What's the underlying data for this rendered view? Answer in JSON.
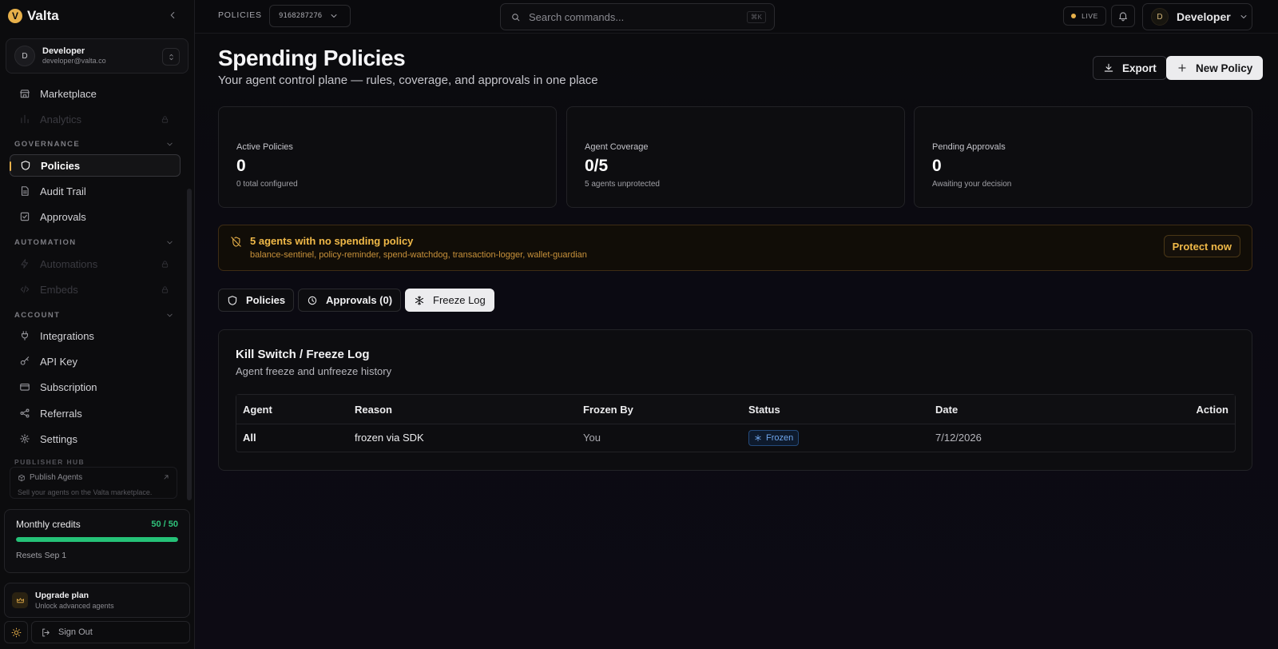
{
  "app": {
    "brand": "Valta",
    "accent_color": "#e7b04a",
    "success_color": "#25c278"
  },
  "sidebar": {
    "user": {
      "initial": "D",
      "name": "Developer",
      "email": "developer@valta.co"
    },
    "top_items": [
      {
        "label": "Marketplace",
        "icon": "store-icon"
      },
      {
        "label": "Analytics",
        "icon": "chart-icon",
        "locked": true
      }
    ],
    "sections": [
      {
        "label": "GOVERNANCE",
        "items": [
          {
            "label": "Policies",
            "icon": "shield-icon",
            "active": true
          },
          {
            "label": "Audit Trail",
            "icon": "file-icon"
          },
          {
            "label": "Approvals",
            "icon": "checkbox-icon"
          }
        ]
      },
      {
        "label": "AUTOMATION",
        "items": [
          {
            "label": "Automations",
            "icon": "zap-icon",
            "locked": true
          },
          {
            "label": "Embeds",
            "icon": "code-icon",
            "locked": true
          }
        ]
      },
      {
        "label": "ACCOUNT",
        "items": [
          {
            "label": "Integrations",
            "icon": "plug-icon"
          },
          {
            "label": "API Key",
            "icon": "key-icon"
          },
          {
            "label": "Subscription",
            "icon": "card-icon"
          },
          {
            "label": "Referrals",
            "icon": "share-icon"
          },
          {
            "label": "Settings",
            "icon": "gear-icon"
          }
        ]
      }
    ],
    "publisher": {
      "section_label": "PUBLISHER HUB",
      "title": "Publish Agents",
      "subtitle": "Sell your agents on the Valta marketplace."
    },
    "credits": {
      "label": "Monthly credits",
      "value_text": "50 / 50",
      "used": 50,
      "total": 50,
      "reset_text": "Resets Sep 1"
    },
    "upgrade": {
      "title": "Upgrade plan",
      "subtitle": "Unlock advanced agents"
    },
    "sign_out": "Sign Out"
  },
  "topbar": {
    "breadcrumb": "POLICIES",
    "id_value": "9168287276",
    "search_placeholder": "Search commands...",
    "shortcut": "⌘K",
    "live_label": "LIVE",
    "profile_initial": "D",
    "profile_name": "Developer"
  },
  "page": {
    "title": "Spending Policies",
    "subtitle": "Your agent control plane — rules, coverage, and approvals in one place",
    "export_label": "Export",
    "new_policy_label": "New Policy",
    "stats": [
      {
        "label": "Active Policies",
        "value": "0",
        "note": "0 total configured"
      },
      {
        "label": "Agent Coverage",
        "value": "0/5",
        "note": "5 agents unprotected"
      },
      {
        "label": "Pending Approvals",
        "value": "0",
        "note": "Awaiting your decision"
      }
    ],
    "alert": {
      "title": "5 agents with no spending policy",
      "agents": "balance-sentinel, policy-reminder, spend-watchdog, transaction-logger, wallet-guardian",
      "action": "Protect now"
    },
    "tabs": [
      {
        "label": "Policies",
        "icon": "shield-icon"
      },
      {
        "label": "Approvals (0)",
        "icon": "clock-icon"
      },
      {
        "label": "Freeze Log",
        "icon": "snowflake-icon",
        "selected": true
      }
    ],
    "freeze_log": {
      "title": "Kill Switch / Freeze Log",
      "subtitle": "Agent freeze and unfreeze history",
      "columns": [
        "Agent",
        "Reason",
        "Frozen By",
        "Status",
        "Date",
        "Action"
      ],
      "rows": [
        {
          "agent": "All",
          "reason": "frozen via SDK",
          "frozen_by": "You",
          "status": "Frozen",
          "date": "7/12/2026",
          "action": ""
        }
      ]
    }
  }
}
